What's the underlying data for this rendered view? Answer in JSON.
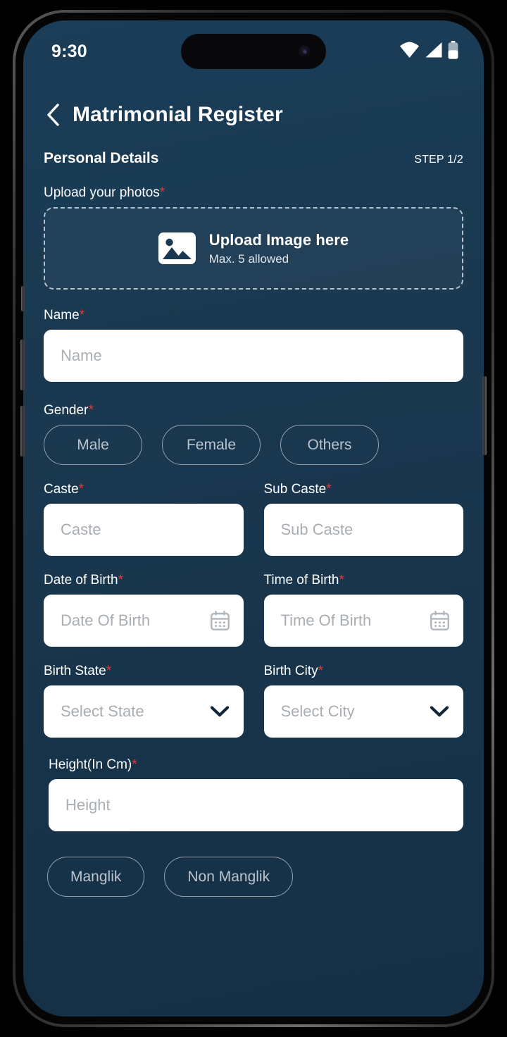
{
  "status_bar": {
    "time": "9:30",
    "icons": [
      "wifi-icon",
      "cellular-signal-icon",
      "battery-icon"
    ],
    "battery_level_percent": 50
  },
  "header": {
    "back_icon": "chevron-left-icon",
    "title": "Matrimonial Register"
  },
  "section": {
    "title": "Personal Details",
    "step": "STEP 1/2"
  },
  "upload": {
    "label": "Upload your photos",
    "required_mark": "*",
    "icon": "image-placeholder-icon",
    "title": "Upload Image here",
    "subtitle": "Max. 5 allowed"
  },
  "fields": {
    "name": {
      "label": "Name",
      "required_mark": "*",
      "placeholder": "Name",
      "value": ""
    },
    "gender": {
      "label": "Gender",
      "required_mark": "*",
      "options": [
        "Male",
        "Female",
        "Others"
      ],
      "selected": ""
    },
    "caste": {
      "label": "Caste",
      "required_mark": "*",
      "placeholder": "Caste",
      "value": ""
    },
    "sub_caste": {
      "label": "Sub Caste",
      "required_mark": "*",
      "placeholder": "Sub Caste",
      "value": ""
    },
    "date_of_birth": {
      "label": "Date of Birth",
      "required_mark": "*",
      "placeholder": "Date Of Birth",
      "value": "",
      "icon": "calendar-icon"
    },
    "time_of_birth": {
      "label": "Time of Birth",
      "required_mark": "*",
      "placeholder": "Time Of Birth",
      "value": "",
      "icon": "calendar-icon"
    },
    "birth_state": {
      "label": "Birth State",
      "required_mark": "*",
      "placeholder": "Select State",
      "value": "",
      "icon": "chevron-down-icon"
    },
    "birth_city": {
      "label": "Birth City",
      "required_mark": "*",
      "placeholder": "Select City",
      "value": "",
      "icon": "chevron-down-icon"
    },
    "height": {
      "label": "Height(In Cm)",
      "required_mark": "*",
      "placeholder": "Height",
      "value": ""
    },
    "manglik": {
      "options": [
        "Manglik",
        "Non Manglik"
      ],
      "selected": ""
    }
  },
  "colors": {
    "background_top": "#1b3d58",
    "background_bottom": "#153045",
    "required_asterisk": "#e23b3b",
    "input_background": "#ffffff",
    "placeholder_text": "#a9aeb3",
    "pill_border": "#93a1ad",
    "pill_text": "#b9c4ce",
    "dashed_border": "#b6c2cd",
    "primary_text": "#ffffff"
  }
}
